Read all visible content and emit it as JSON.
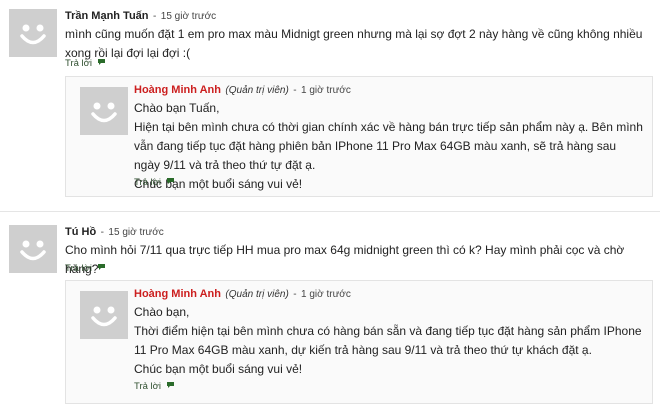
{
  "comments": [
    {
      "author": "Trần Mạnh Tuấn",
      "time": "15 giờ trước",
      "body": "mình cũng muốn đặt 1 em pro max màu Midnigt green nhưng mà lại sợ đợt 2 này hàng về cũng không nhiều xong rồi lại đợi lại đợi :(",
      "reply_label": "Trả lời",
      "answer": {
        "author": "Hoàng Minh Anh",
        "role": "(Quản trị viên)",
        "time": "1 giờ trước",
        "greeting": "Chào bạn Tuấn,",
        "body": "Hiện tại bên mình chưa có thời gian chính xác về hàng bán trực tiếp sản phẩm này ạ. Bên mình vẫn đang tiếp tục đặt hàng phiên bản IPhone 11 Pro Max 64GB màu xanh, sẽ trả hàng sau ngày 9/11 và trả theo thứ tự đặt ạ.",
        "closing": "Chúc bạn một buổi sáng vui vẻ!",
        "reply_label": "Trả lời"
      }
    },
    {
      "author": "Tú Hồ",
      "time": "15 giờ trước",
      "body": "Cho mình hỏi 7/11 qua trực tiếp HH mua pro max 64g midnight green thì có k? Hay mình phải cọc và chờ hàng?",
      "reply_label": "Trả lời",
      "answer": {
        "author": "Hoàng Minh Anh",
        "role": "(Quản trị viên)",
        "time": "1 giờ trước",
        "greeting": "Chào bạn,",
        "body": "Thời điểm hiện tại bên mình chưa có hàng bán sẵn và đang tiếp tục đặt hàng sản phẩm IPhone 11 Pro Max 64GB màu xanh, dự kiến trả hàng sau 9/11 và trả theo thứ tự khách đặt ạ.",
        "closing": "Chúc bạn một buổi sáng vui vẻ!",
        "reply_label": "Trả lời"
      }
    }
  ],
  "separator": "-",
  "colors": {
    "admin_name": "#cc1f1f",
    "reply_icon": "#2a6b2a",
    "avatar_bg": "#cfcfcf"
  }
}
